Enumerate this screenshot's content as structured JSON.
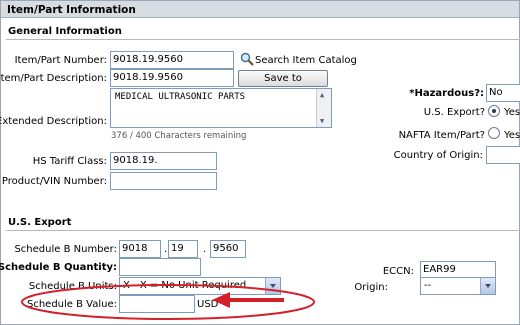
{
  "panel": {
    "title": "Item/Part Information"
  },
  "general": {
    "heading": "General Information",
    "item_number_label": "Item/Part Number:",
    "item_number_value": "9018.19.9560",
    "search_catalog_label": "Search Item Catalog",
    "description_label": "Item/Part Description:",
    "description_value": "9018.19.9560",
    "save_catalog_label": "Save to catalog",
    "extended_label": "Extended Description:",
    "extended_value": "MEDICAL ULTRASONIC PARTS",
    "chars_remaining": "376 / 400 Characters remaining",
    "tariff_label": "HS Tariff Class:",
    "tariff_value": "9018.19.",
    "vin_label": "Product/VIN Number:",
    "vin_value": "",
    "hazardous_label": "*Hazardous?:",
    "hazardous_value": "No",
    "us_export_label": "U.S. Export?",
    "us_export_yes": "Yes",
    "nafta_label": "NAFTA Item/Part?",
    "nafta_yes": "Yes",
    "origin_country_label": "Country of Origin:",
    "origin_country_value": ""
  },
  "us_export": {
    "heading": "U.S. Export",
    "schedule_b_number_label": "Schedule B Number:",
    "schedule_b_part1": "9018",
    "schedule_b_part2": "19",
    "schedule_b_part3": "9560",
    "schedule_b_separator": ".",
    "schedule_b_quantity_label": "*Schedule B Quantity:",
    "schedule_b_quantity_value": "",
    "schedule_b_units_label": "Schedule B Units:",
    "schedule_b_units_value": "X - X = No Unit Required",
    "schedule_b_value_label": "Schedule B Value:",
    "schedule_b_value_value": "",
    "currency": "USD",
    "eccn_label": "ECCN:",
    "eccn_value": "EAR99",
    "origin_label": "Origin:",
    "origin_value": "--"
  },
  "colors": {
    "annotation": "#d4202a",
    "header_bg": "#d7dce3",
    "input_border": "#7f9db9"
  }
}
